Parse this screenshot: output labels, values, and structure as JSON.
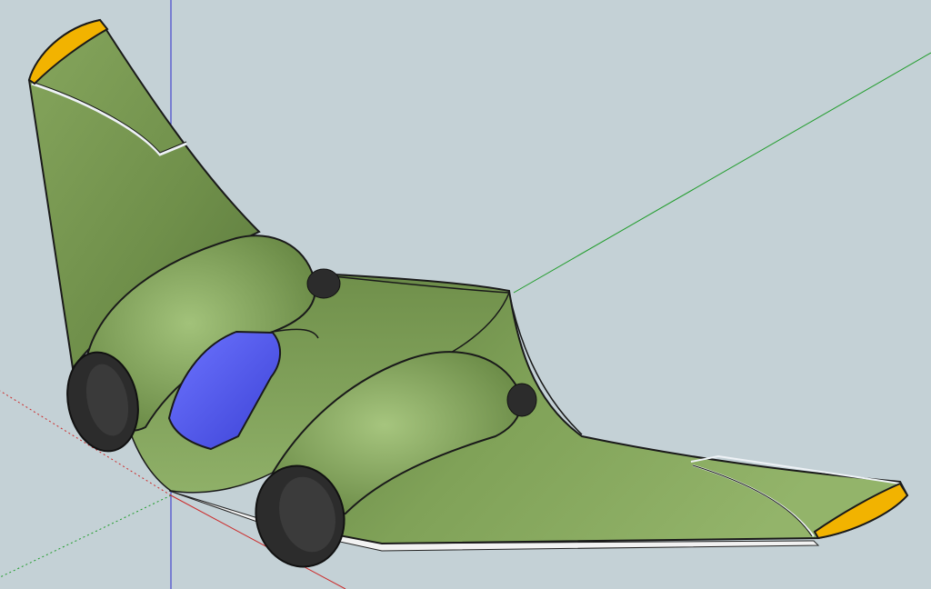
{
  "scene": {
    "background_color": "#c4d1d6",
    "axes": {
      "red_axis_color": "#cc2a2a",
      "green_axis_color": "#1f9c2a",
      "blue_axis_color": "#2b2bcc"
    },
    "model": {
      "body_color": "#7f9e56",
      "body_dark_color": "#4f6a34",
      "body_light_color": "#9cbb73",
      "wingtip_color": "#f2b300",
      "canopy_color": "#4a4ee6",
      "engine_intake_color": "#2c2c2c",
      "underside_color": "#f2f2f2"
    }
  }
}
